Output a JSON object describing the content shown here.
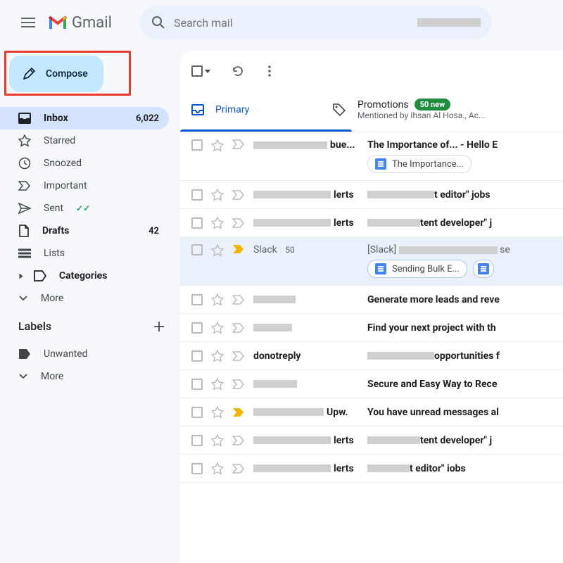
{
  "header": {
    "brand": "Gmail",
    "search_placeholder": "Search mail"
  },
  "compose": {
    "label": "Compose"
  },
  "sidebar": {
    "items": [
      {
        "label": "Inbox",
        "count": "6,022"
      },
      {
        "label": "Starred"
      },
      {
        "label": "Snoozed"
      },
      {
        "label": "Important"
      },
      {
        "label": "Sent"
      },
      {
        "label": "Drafts",
        "count": "42"
      },
      {
        "label": "Lists"
      },
      {
        "label": "Categories"
      },
      {
        "label": "More"
      }
    ],
    "labels_header": "Labels",
    "labels": [
      {
        "label": "Unwanted"
      },
      {
        "label": "More"
      }
    ]
  },
  "tabs": {
    "primary": "Primary",
    "promotions": {
      "title": "Promotions",
      "badge": "50 new",
      "sub": "Mentioned by Ihsan Al Hosa., Ac..."
    }
  },
  "mails": [
    {
      "sender_suffix": "bue...",
      "subject": "The Importance of... - Hello E",
      "chip": "The Importance..."
    },
    {
      "sender_suffix": "lerts",
      "subject_suffix": "t editor\" jobs "
    },
    {
      "sender_suffix": "lerts",
      "subject_suffix": "tent developer\" j"
    },
    {
      "sender": "Slack",
      "sender_count": "50",
      "subject_prefix": "[Slack] ",
      "subject_suffix": " se",
      "chip": "Sending Bulk E..."
    },
    {
      "subject": "Generate more leads and reve"
    },
    {
      "subject": "Find your next project with th"
    },
    {
      "sender": "donotreply",
      "subject_suffix": "opportunities f"
    },
    {
      "subject": "Secure and Easy Way to Rece"
    },
    {
      "sender_suffix": "Upw.",
      "subject": "You have unread messages al"
    },
    {
      "sender_suffix": "lerts",
      "subject_suffix": "tent developer\" j"
    },
    {
      "sender_suffix": "lerts",
      "subject_suffix": "t editor\" iobs "
    }
  ]
}
